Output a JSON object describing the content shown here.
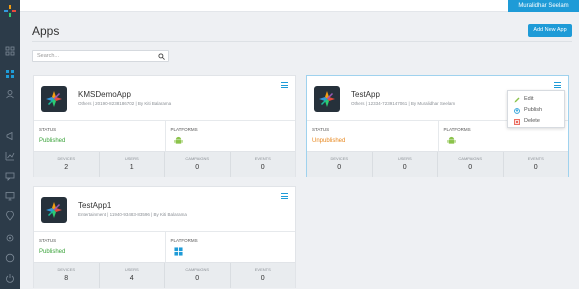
{
  "topbar": {
    "user_name": "Muralidhar Seelam"
  },
  "page": {
    "title": "Apps",
    "add_button": "Add New App"
  },
  "search": {
    "placeholder": "Search..."
  },
  "labels": {
    "status": "STATUS",
    "platforms": "PLATFORMS",
    "devices": "DEVICES",
    "users": "USERS",
    "campaigns": "CAMPAIGNS",
    "events": "EVENTS"
  },
  "apps": [
    {
      "name": "KMSDemoApp",
      "meta": "Others | 20190-8238186702 | By Kiti Balarama",
      "status": "Published",
      "status_color": "#3aa33a",
      "platform": "android",
      "stats": {
        "devices": "2",
        "users": "1",
        "campaigns": "0",
        "events": "0"
      }
    },
    {
      "name": "TestApp",
      "meta": "Others | 12334-7239147061 | By Muralidhar Seelam",
      "status": "Unpublished",
      "status_color": "#e8881f",
      "platform": "android",
      "stats": {
        "devices": "0",
        "users": "0",
        "campaigns": "0",
        "events": "0"
      }
    },
    {
      "name": "TestApp1",
      "meta": "Entertainment | 11940-93483-83596 | By Kiti Balarama",
      "status": "Published",
      "status_color": "#3aa33a",
      "platform": "windows",
      "stats": {
        "devices": "8",
        "users": "4",
        "campaigns": "0",
        "events": "0"
      }
    }
  ],
  "dropdown": {
    "items": [
      "Edit",
      "Publish",
      "Delete"
    ]
  },
  "colors": {
    "accent": "#1e9bd7",
    "sidebar": "#2c3b49",
    "android": "#8bc34a",
    "windows": "#1e9bd7"
  }
}
